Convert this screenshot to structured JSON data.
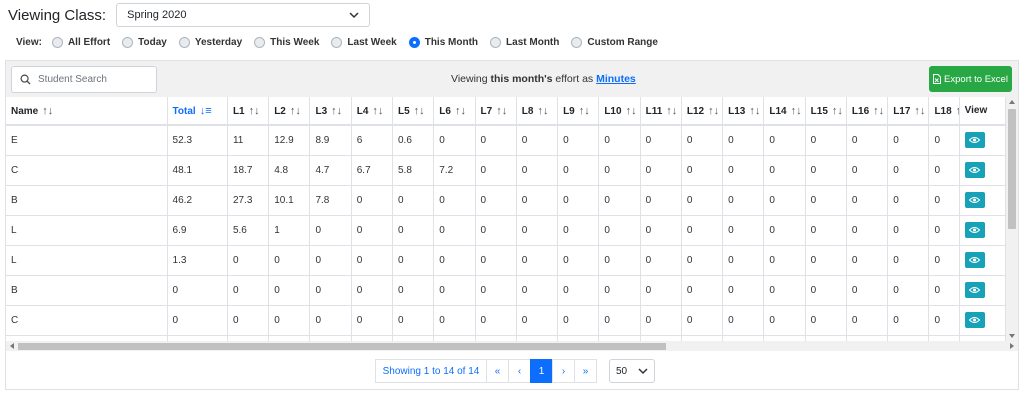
{
  "header": {
    "viewing_class_label": "Viewing Class:",
    "class_select_value": "Spring 2020"
  },
  "view_filter": {
    "label": "View:",
    "options": [
      {
        "label": "All Effort",
        "selected": false
      },
      {
        "label": "Today",
        "selected": false
      },
      {
        "label": "Yesterday",
        "selected": false
      },
      {
        "label": "This Week",
        "selected": false
      },
      {
        "label": "Last Week",
        "selected": false
      },
      {
        "label": "This Month",
        "selected": true
      },
      {
        "label": "Last Month",
        "selected": false
      },
      {
        "label": "Custom Range",
        "selected": false
      }
    ]
  },
  "toolbar": {
    "search_placeholder": "Student Search",
    "viewing_prefix": "Viewing ",
    "viewing_period": "this month's",
    "viewing_middle": " effort as ",
    "viewing_unit": "Minutes",
    "export_label": "Export to Excel"
  },
  "table": {
    "columns": [
      {
        "label": "Name",
        "sort": "↑↓",
        "active": false
      },
      {
        "label": "Total",
        "sort": "↓≡",
        "active": true
      },
      {
        "label": "L1",
        "sort": "↑↓",
        "active": false
      },
      {
        "label": "L2",
        "sort": "↑↓",
        "active": false
      },
      {
        "label": "L3",
        "sort": "↑↓",
        "active": false
      },
      {
        "label": "L4",
        "sort": "↑↓",
        "active": false
      },
      {
        "label": "L5",
        "sort": "↑↓",
        "active": false
      },
      {
        "label": "L6",
        "sort": "↑↓",
        "active": false
      },
      {
        "label": "L7",
        "sort": "↑↓",
        "active": false
      },
      {
        "label": "L8",
        "sort": "↑↓",
        "active": false
      },
      {
        "label": "L9",
        "sort": "↑↓",
        "active": false
      },
      {
        "label": "L10",
        "sort": "↑↓",
        "active": false
      },
      {
        "label": "L11",
        "sort": "↑↓",
        "active": false
      },
      {
        "label": "L12",
        "sort": "↑↓",
        "active": false
      },
      {
        "label": "L13",
        "sort": "↑↓",
        "active": false
      },
      {
        "label": "L14",
        "sort": "↑↓",
        "active": false
      },
      {
        "label": "L15",
        "sort": "↑↓",
        "active": false
      },
      {
        "label": "L16",
        "sort": "↑↓",
        "active": false
      },
      {
        "label": "L17",
        "sort": "↑↓",
        "active": false
      },
      {
        "label": "L18",
        "sort": "↑",
        "active": false
      },
      {
        "label": "View",
        "sort": "",
        "active": false
      }
    ],
    "rows": [
      [
        "E",
        "52.3",
        "11",
        "12.9",
        "8.9",
        "6",
        "0.6",
        "0",
        "0",
        "0",
        "0",
        "0",
        "0",
        "0",
        "0",
        "0",
        "0",
        "0",
        "0",
        "0"
      ],
      [
        "C",
        "48.1",
        "18.7",
        "4.8",
        "4.7",
        "6.7",
        "5.8",
        "7.2",
        "0",
        "0",
        "0",
        "0",
        "0",
        "0",
        "0",
        "0",
        "0",
        "0",
        "0",
        "0"
      ],
      [
        "B",
        "46.2",
        "27.3",
        "10.1",
        "7.8",
        "0",
        "0",
        "0",
        "0",
        "0",
        "0",
        "0",
        "0",
        "0",
        "0",
        "0",
        "0",
        "0",
        "0",
        "0"
      ],
      [
        "L",
        "6.9",
        "5.6",
        "1",
        "0",
        "0",
        "0",
        "0",
        "0",
        "0",
        "0",
        "0",
        "0",
        "0",
        "0",
        "0",
        "0",
        "0",
        "0",
        "0"
      ],
      [
        "L",
        "1.3",
        "0",
        "0",
        "0",
        "0",
        "0",
        "0",
        "0",
        "0",
        "0",
        "0",
        "0",
        "0",
        "0",
        "0",
        "0",
        "0",
        "0",
        "0"
      ],
      [
        "B",
        "0",
        "0",
        "0",
        "0",
        "0",
        "0",
        "0",
        "0",
        "0",
        "0",
        "0",
        "0",
        "0",
        "0",
        "0",
        "0",
        "0",
        "0",
        "0"
      ],
      [
        "C",
        "0",
        "0",
        "0",
        "0",
        "0",
        "0",
        "0",
        "0",
        "0",
        "0",
        "0",
        "0",
        "0",
        "0",
        "0",
        "0",
        "0",
        "0",
        "0"
      ],
      [
        "",
        "",
        "",
        "",
        "",
        "",
        "",
        "",
        "",
        "",
        "",
        "",
        "",
        "",
        "",
        "",
        "",
        "",
        "",
        ""
      ]
    ]
  },
  "pagination": {
    "info": "Showing 1 to 14 of 14",
    "first": "«",
    "prev": "‹",
    "current": "1",
    "next": "›",
    "last": "»",
    "per_page": "50"
  },
  "colors": {
    "primary": "#0d6efd",
    "export_green": "#28a745",
    "view_button": "#17a2b8"
  }
}
